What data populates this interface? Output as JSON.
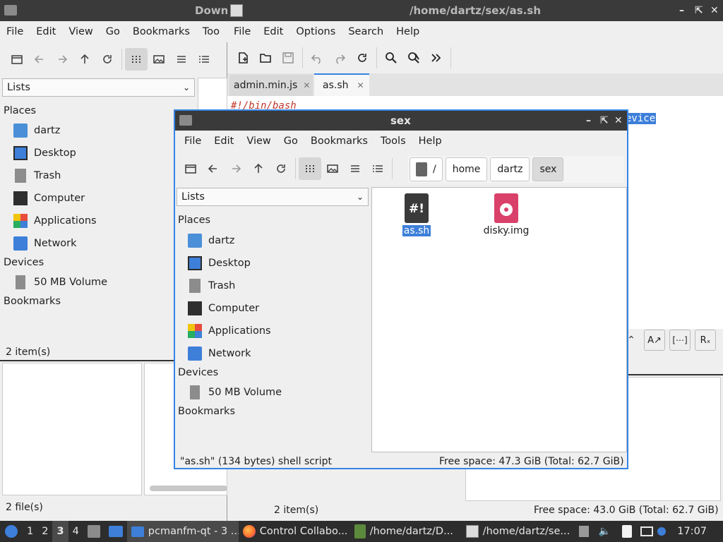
{
  "left_window": {
    "title": "Down",
    "menu": [
      "File",
      "Edit",
      "View",
      "Go",
      "Bookmarks",
      "Too"
    ],
    "combo_value": "Lists",
    "places_header": "Places",
    "places": [
      "dartz",
      "Desktop",
      "Trash",
      "Computer",
      "Applications",
      "Network"
    ],
    "devices_header": "Devices",
    "devices": [
      "50 MB Volume"
    ],
    "bookmarks_header": "Bookmarks",
    "status": "2 item(s)",
    "bottom_status": "2 file(s)"
  },
  "editor_window": {
    "title": "/home/dartz/sex/as.sh",
    "menu": [
      "File",
      "Edit",
      "Options",
      "Search",
      "Help"
    ],
    "tabs": [
      {
        "label": "admin.min.js"
      },
      {
        "label": "as.sh"
      }
    ],
    "code_line1": "#!/bin/bash",
    "code_selected": "evice",
    "status_left": "2 item(s)",
    "status_right": "Free space: 43.0 GiB (Total: 62.7 GiB)"
  },
  "main_window": {
    "title": "sex",
    "menu": [
      "File",
      "Edit",
      "View",
      "Go",
      "Bookmarks",
      "Tools",
      "Help"
    ],
    "path": [
      "/",
      "home",
      "dartz",
      "sex"
    ],
    "combo_value": "Lists",
    "places_header": "Places",
    "places": [
      "dartz",
      "Desktop",
      "Trash",
      "Computer",
      "Applications",
      "Network"
    ],
    "devices_header": "Devices",
    "devices": [
      "50 MB Volume"
    ],
    "bookmarks_header": "Bookmarks",
    "files": [
      {
        "name": "as.sh",
        "icon": "shell-script-icon",
        "selected": true
      },
      {
        "name": "disky.img",
        "icon": "disk-image-icon",
        "selected": false
      }
    ],
    "status_left": "\"as.sh\" (134 bytes) shell script",
    "status_right": "Free space: 47.3 GiB (Total: 62.7 GiB)"
  },
  "taskbar": {
    "workspaces": [
      "1",
      "2",
      "3",
      "4"
    ],
    "active_workspace": "3",
    "tasks": [
      {
        "label": "pcmanfm-qt - 3 ...",
        "icon": "folder-icon"
      },
      {
        "label": "Control Collabo...",
        "icon": "firefox-icon"
      },
      {
        "label": "/home/dartz/D...",
        "icon": "archive-icon"
      },
      {
        "label": "/home/dartz/se...",
        "icon": "text-editor-icon"
      }
    ],
    "clock": "17:07"
  },
  "colors": {
    "accent": "#3584e4",
    "titlebar": "#3a3a3a",
    "selection": "#3d7fd9"
  }
}
